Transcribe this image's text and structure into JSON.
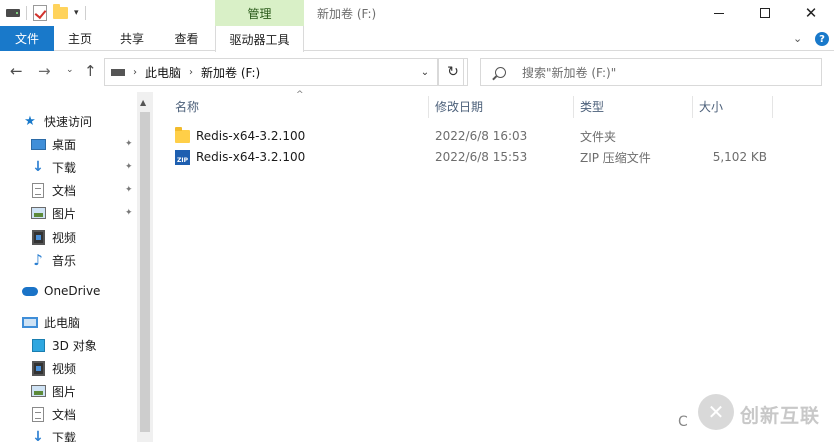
{
  "titlebar": {
    "context_group": "管理",
    "window_title": "新加卷 (F:)",
    "close_glyph": "✕"
  },
  "ribbon": {
    "tabs": [
      "文件",
      "主页",
      "共享",
      "查看",
      "驱动器工具"
    ],
    "help_glyph": "?"
  },
  "address": {
    "segments": [
      "此电脑",
      "新加卷 (F:)"
    ],
    "search_placeholder": "搜索\"新加卷 (F:)\""
  },
  "navpane": {
    "quick_access": "快速访问",
    "quick_items": [
      {
        "label": "桌面",
        "icon": "desktop-icon"
      },
      {
        "label": "下载",
        "icon": "download-icon"
      },
      {
        "label": "文档",
        "icon": "document-icon"
      },
      {
        "label": "图片",
        "icon": "pictures-icon"
      },
      {
        "label": "视频",
        "icon": "video-icon"
      },
      {
        "label": "音乐",
        "icon": "music-icon"
      }
    ],
    "onedrive": "OneDrive",
    "this_pc": "此电脑",
    "pc_items": [
      {
        "label": "3D 对象",
        "icon": "3d-objects-icon"
      },
      {
        "label": "视频",
        "icon": "video-icon"
      },
      {
        "label": "图片",
        "icon": "pictures-icon"
      },
      {
        "label": "文档",
        "icon": "document-icon"
      },
      {
        "label": "下载",
        "icon": "download-icon"
      }
    ]
  },
  "columns": {
    "name": "名称",
    "modified": "修改日期",
    "type": "类型",
    "size": "大小"
  },
  "files": [
    {
      "name": "Redis-x64-3.2.100",
      "modified": "2022/6/8 16:03",
      "type": "文件夹",
      "size": "",
      "icon": "folder-icon"
    },
    {
      "name": "Redis-x64-3.2.100",
      "modified": "2022/6/8 15:53",
      "type": "ZIP 压缩文件",
      "size": "5,102 KB",
      "icon": "zip-file-icon"
    }
  ],
  "watermark": {
    "text": "创新互联",
    "letter": "C"
  },
  "colors": {
    "accent": "#1979ca",
    "context_tab": "#d9f0c7",
    "folder": "#ffcf48"
  }
}
